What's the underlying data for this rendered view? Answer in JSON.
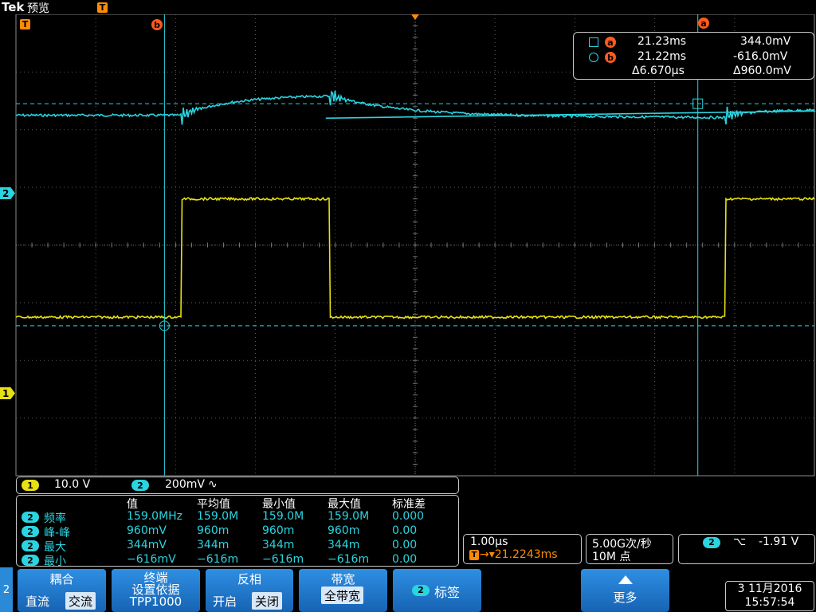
{
  "brand": "Tek",
  "mode": "预览",
  "colors": {
    "ch1": "#e8e010",
    "ch2": "#2ad4e0",
    "cursor": "#2ad4e0",
    "cursor_badge": "#ff5a1e",
    "trigger": "#ff8c00",
    "menu_button": "#1f78d0"
  },
  "markers": {
    "trigger_position": "T",
    "cursor_a": "a",
    "cursor_b": "b",
    "ch1": "1",
    "ch2": "2"
  },
  "cursor_readout": {
    "a_symbol": "square",
    "b_symbol": "circle",
    "a_time": "21.23ms",
    "a_value": "344.0mV",
    "b_time": "21.22ms",
    "b_value": "-616.0mV",
    "delta_time": "Δ6.670µs",
    "delta_value": "Δ960.0mV"
  },
  "channels": {
    "ch1_num": "1",
    "ch1_scale": "10.0 V",
    "ch2_num": "2",
    "ch2_scale": "200mV",
    "ch2_coupling_icon": "∿"
  },
  "measurements": {
    "headers": [
      "值",
      "平均值",
      "最小值",
      "最大值",
      "标准差"
    ],
    "rows": [
      {
        "ch": "2",
        "name": "频率",
        "value": "159.0MHz",
        "mean": "159.0M",
        "min": "159.0M",
        "max": "159.0M",
        "std": "0.000"
      },
      {
        "ch": "2",
        "name": "峰-峰",
        "value": "960mV",
        "mean": "960m",
        "min": "960m",
        "max": "960m",
        "std": "0.00"
      },
      {
        "ch": "2",
        "name": "最大",
        "value": "344mV",
        "mean": "344m",
        "min": "344m",
        "max": "344m",
        "std": "0.00"
      },
      {
        "ch": "2",
        "name": "最小",
        "value": "−616mV",
        "mean": "−616m",
        "min": "−616m",
        "max": "−616m",
        "std": "0.00"
      }
    ]
  },
  "horizontal": {
    "scale": "1.00µs",
    "trigger_icon": "T",
    "position": "→▾21.2243ms"
  },
  "acquisition": {
    "sample_rate": "5.00G次/秒",
    "record_length": "10M 点"
  },
  "trigger": {
    "source": "2",
    "slope_icon": "falling-edge-icon",
    "slope_glyph": "⌥",
    "level": "-1.91 V"
  },
  "menu": {
    "side_label": "2",
    "coupling_title": "耦合",
    "coupling_dc": "直流",
    "coupling_ac": "交流",
    "termination_title_1": "终端",
    "termination_title_2": "设置依据",
    "termination_value": "TPP1000",
    "invert_title": "反相",
    "invert_on": "开启",
    "invert_off": "关闭",
    "bandwidth_title": "带宽",
    "bandwidth_value": "全带宽",
    "label_ch": "2",
    "label_text": "标签",
    "more_text": "更多"
  },
  "datetime": {
    "date": "3 11月2016",
    "time": "15:57:54"
  }
}
